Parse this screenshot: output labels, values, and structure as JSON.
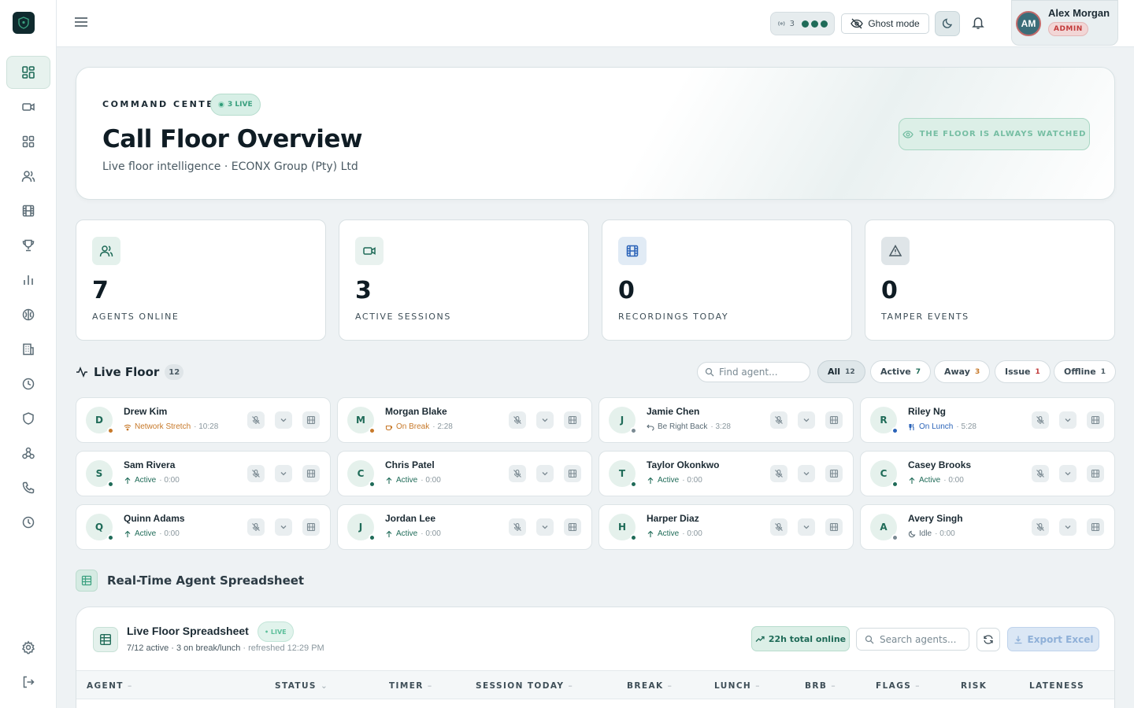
{
  "topbar": {
    "signal_count": "3",
    "ghost_label": "Ghost mode",
    "user_initials": "AM",
    "user_name": "Alex Morgan",
    "user_role": "ADMIN"
  },
  "hero": {
    "kicker": "COMMAND CENTER",
    "live_badge": "3 LIVE",
    "title": "Call Floor Overview",
    "subtitle": "Live floor intelligence · ECONX Group (Pty) Ltd",
    "watch_label": "THE FLOOR IS ALWAYS WATCHED"
  },
  "stats": [
    {
      "value": "7",
      "label": "AGENTS ONLINE"
    },
    {
      "value": "3",
      "label": "ACTIVE SESSIONS"
    },
    {
      "value": "0",
      "label": "RECORDINGS TODAY"
    },
    {
      "value": "0",
      "label": "TAMPER EVENTS"
    }
  ],
  "live_floor": {
    "title": "Live Floor",
    "count": "12",
    "search_placeholder": "Find agent...",
    "filters": [
      {
        "label": "All",
        "count": "12"
      },
      {
        "label": "Active",
        "count": "7"
      },
      {
        "label": "Away",
        "count": "3"
      },
      {
        "label": "Issue",
        "count": "1"
      },
      {
        "label": "Offline",
        "count": "1"
      }
    ],
    "agents": [
      {
        "initial": "D",
        "name": "Drew Kim",
        "status": "Network Stretch",
        "time": "· 10:28"
      },
      {
        "initial": "M",
        "name": "Morgan Blake",
        "status": "On Break",
        "time": "· 2:28"
      },
      {
        "initial": "J",
        "name": "Jamie Chen",
        "status": "Be Right Back",
        "time": "· 3:28"
      },
      {
        "initial": "R",
        "name": "Riley Ng",
        "status": "On Lunch",
        "time": "· 5:28"
      },
      {
        "initial": "S",
        "name": "Sam Rivera",
        "status": "Active",
        "time": "· 0:00"
      },
      {
        "initial": "C",
        "name": "Chris Patel",
        "status": "Active",
        "time": "· 0:00"
      },
      {
        "initial": "T",
        "name": "Taylor Okonkwo",
        "status": "Active",
        "time": "· 0:00"
      },
      {
        "initial": "C",
        "name": "Casey Brooks",
        "status": "Active",
        "time": "· 0:00"
      },
      {
        "initial": "Q",
        "name": "Quinn Adams",
        "status": "Active",
        "time": "· 0:00"
      },
      {
        "initial": "J",
        "name": "Jordan Lee",
        "status": "Active",
        "time": "· 0:00"
      },
      {
        "initial": "H",
        "name": "Harper Diaz",
        "status": "Active",
        "time": "· 0:00"
      },
      {
        "initial": "A",
        "name": "Avery Singh",
        "status": "Idle",
        "time": "· 0:00"
      }
    ]
  },
  "spreadsheet": {
    "section_title": "Real-Time Agent Spreadsheet",
    "title": "Live Floor Spreadsheet",
    "live_badge": "• LIVE",
    "sub_main": "7/12 active · 3 on break/lunch",
    "sub_refresh": " · refreshed 12:29 PM",
    "total_online": "22h total online",
    "search_placeholder": "Search agents...",
    "export_label": "Export Excel",
    "columns": [
      "AGENT",
      "STATUS",
      "TIMER",
      "SESSION TODAY",
      "BREAK",
      "LUNCH",
      "BRB",
      "FLAGS",
      "RISK",
      "LATENESS"
    ]
  },
  "colors": {
    "accent": "#1f6b58",
    "status_active": "#1f6b58",
    "status_network": "#c7792a",
    "status_break": "#c7792a",
    "status_brb": "#5a6b75",
    "status_lunch": "#2a63b8",
    "status_idle": "#5a6b75"
  }
}
